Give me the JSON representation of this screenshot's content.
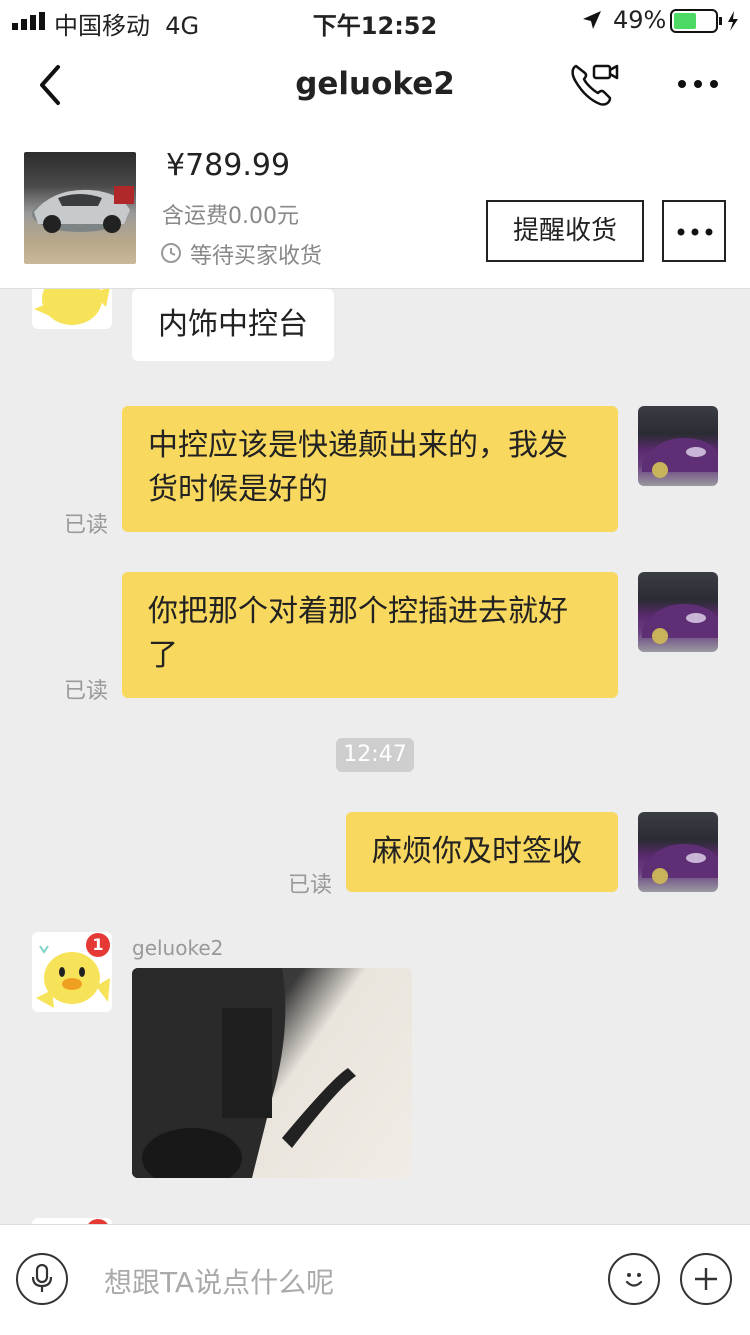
{
  "status_bar": {
    "carrier": "中国移动",
    "network": "4G",
    "time": "下午12:52",
    "battery": "49%"
  },
  "nav": {
    "title": "geluoke2"
  },
  "product": {
    "price": "¥789.99",
    "shipping": "含运费0.00元",
    "status": "等待买家收货",
    "remind_label": "提醒收货"
  },
  "messages": {
    "m1_text": "内饰中控台",
    "m2_text_l1": "中控应该是快递颠出来的，我发",
    "m2_text_l2": "货时候是好的",
    "m3_text_l1": "你把那个对着那个控插进去就好",
    "m3_text_l2": "了",
    "m4_text": "麻烦你及时签收",
    "read_label": "已读",
    "timestamp": "12:47",
    "sender_name": "geluoke2",
    "badge_count": "1"
  },
  "input": {
    "placeholder": "想跟TA说点什么呢"
  },
  "colors": {
    "bubble_out": "#f8d85e",
    "background": "#ededed",
    "badge": "#e53935"
  }
}
